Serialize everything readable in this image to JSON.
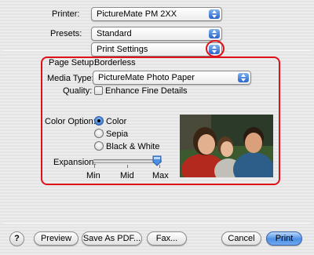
{
  "printer": {
    "label": "Printer:",
    "value": "PictureMate PM 2XX"
  },
  "presets": {
    "label": "Presets:",
    "value": "Standard"
  },
  "pane_selector": {
    "value": "Print Settings"
  },
  "page_setup": {
    "label": "Page Setup:",
    "value": "Borderless"
  },
  "media_type": {
    "label": "Media Type:",
    "value": "PictureMate Photo Paper"
  },
  "quality": {
    "label": "Quality:",
    "option_label": "Enhance Fine Details",
    "checked": false
  },
  "color_option": {
    "label": "Color Option:",
    "options": [
      "Color",
      "Sepia",
      "Black & White"
    ],
    "selected": "Color"
  },
  "expansion": {
    "label": "Expansion:",
    "tick_labels": [
      "Min",
      "Mid",
      "Max"
    ],
    "level": "Max"
  },
  "buttons": {
    "help": "?",
    "preview": "Preview",
    "save_as_pdf": "Save As PDF...",
    "fax": "Fax...",
    "cancel": "Cancel",
    "print": "Print"
  },
  "colors": {
    "highlight_red": "#e0101a",
    "accent_blue": "#2a63c9"
  },
  "preview_image": {
    "icon": "family-photo-preview"
  }
}
